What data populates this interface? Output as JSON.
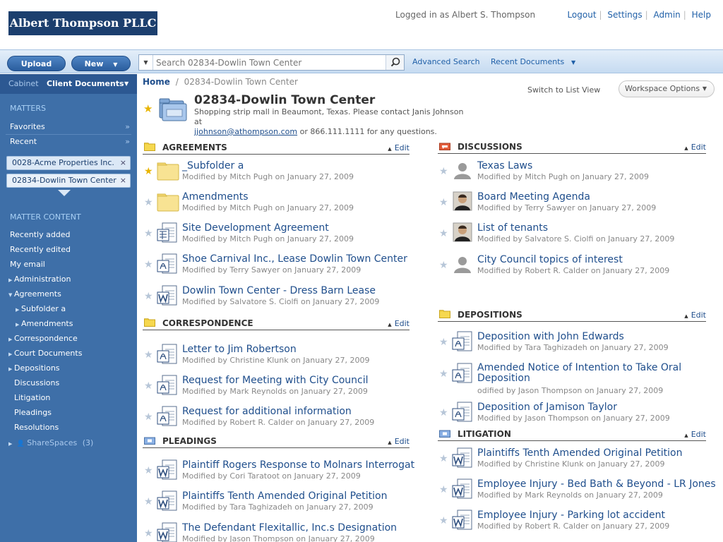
{
  "header": {
    "logo": "Albert Thompson PLLC",
    "logged_in": "Logged in as Albert S. Thompson",
    "links": [
      "Logout",
      "Settings",
      "Admin",
      "Help"
    ],
    "separator": "|"
  },
  "toolbar": {
    "upload": "Upload",
    "new": "New",
    "search_placeholder": "Search 02834-Dowlin Town Center",
    "advanced_search": "Advanced Search",
    "recent_documents": "Recent Documents"
  },
  "sidebar": {
    "cabinet_label": "Cabinet",
    "cabinet_value": "Client Documents",
    "matters_head": "MATTERS",
    "favorites": "Favorites",
    "recent": "Recent",
    "chevron": "»",
    "chip_close": "×",
    "matter_chips": [
      "0028-Acme Properties Inc.",
      "02834-Dowlin Town Center"
    ],
    "matter_content_head": "MATTER CONTENT",
    "content_links": [
      "Recently added",
      "Recently edited",
      "My email"
    ],
    "tree": [
      {
        "label": "Administration",
        "indent": 0,
        "open": false
      },
      {
        "label": "Agreements",
        "indent": 0,
        "open": true
      },
      {
        "label": "Subfolder a",
        "indent": 1,
        "open": false
      },
      {
        "label": "Amendments",
        "indent": 1,
        "open": false
      },
      {
        "label": "Correspondence",
        "indent": 0,
        "open": false
      },
      {
        "label": "Court Documents",
        "indent": 0,
        "open": false
      },
      {
        "label": "Depositions",
        "indent": 0,
        "open": false
      },
      {
        "label": "Discussions",
        "indent": 0,
        "open": null
      },
      {
        "label": "Litigation",
        "indent": 0,
        "open": null
      },
      {
        "label": "Pleadings",
        "indent": 0,
        "open": null
      },
      {
        "label": "Resolutions",
        "indent": 0,
        "open": null
      }
    ],
    "sharespaces": "ShareSpaces",
    "sharespaces_count": "(3)"
  },
  "main": {
    "breadcrumb_home": "Home",
    "breadcrumb_sep": "/",
    "breadcrumb_current": "02834-Dowlin Town Center",
    "switch_view": "Switch to List View",
    "workspace_options": "Workspace Options",
    "title": "02834-Dowlin Town Center",
    "desc_1": "Shopping strip mall in Beaumont, Texas.  Please contact Janis Johnson at",
    "desc_email": "jjohnson@athompson.com",
    "desc_2": " or 866.111.1111 for any questions.",
    "edit_label": "Edit"
  },
  "sections": {
    "agreements": {
      "title": "AGREEMENTS",
      "items": [
        {
          "title": "_Subfolder a",
          "meta": "Modified by Mitch Pugh on January 27, 2009",
          "icon": "folder-icon",
          "fav": true
        },
        {
          "title": "Amendments",
          "meta": "Modified by Mitch Pugh on January 27, 2009",
          "icon": "folder-icon",
          "fav": false
        },
        {
          "title": "Site Development Agreement",
          "meta": "Modified by Mitch Pugh on January 27, 2009",
          "icon": "excel-doc-icon",
          "fav": false
        },
        {
          "title": "Shoe Carnival Inc., Lease Dowlin Town Center",
          "meta": "Modified by Terry Sawyer on January 27, 2009",
          "icon": "pdf-doc-icon",
          "fav": false
        },
        {
          "title": "Dowlin Town Center - Dress Barn Lease",
          "meta": "Modified by Salvatore S. Ciolfi on January 27, 2009",
          "icon": "word-doc-icon",
          "fav": false
        }
      ]
    },
    "correspondence": {
      "title": "CORRESPONDENCE",
      "items": [
        {
          "title": "Letter to Jim Robertson",
          "meta": "Modified by Christine Klunk on January 27, 2009",
          "icon": "pdf-doc-icon"
        },
        {
          "title": "Request for Meeting with City Council",
          "meta": "Modified by Mark Reynolds on January 27, 2009",
          "icon": "pdf-doc-icon"
        },
        {
          "title": "Request for additional information",
          "meta": "Modified by Robert R. Calder on January 27, 2009",
          "icon": "pdf-doc-icon"
        }
      ]
    },
    "pleadings": {
      "title": "PLEADINGS",
      "items": [
        {
          "title": "Plaintiff Rogers Response to Molnars Interrogat",
          "meta": "Modified by Cori Taratoot on January 27, 2009",
          "icon": "word-doc-icon"
        },
        {
          "title": "Plaintiffs Tenth Amended Original Petition",
          "meta": "Modified by Tara Taghizadeh on January 27, 2009",
          "icon": "word-doc-icon"
        },
        {
          "title": "The Defendant Flexitallic, Inc.s Designation",
          "meta": "Modified by Jason Thompson on January 27, 2009",
          "icon": "word-doc-icon"
        }
      ]
    },
    "discussions": {
      "title": "DISCUSSIONS",
      "items": [
        {
          "title": "Texas Laws",
          "meta": "Modified by Mitch Pugh on January 27, 2009",
          "icon": "person-placeholder-icon"
        },
        {
          "title": "Board Meeting Agenda",
          "meta": "Modified by Terry Sawyer on January 27, 2009",
          "icon": "user-photo-icon"
        },
        {
          "title": "List of tenants",
          "meta": "Modified by Salvatore S. Ciolfi on January 27, 2009",
          "icon": "user-photo-icon"
        },
        {
          "title": "City Council topics of interest",
          "meta": "Modified by Robert R. Calder on January 27, 2009",
          "icon": "person-placeholder-icon"
        }
      ]
    },
    "depositions": {
      "title": "DEPOSITIONS",
      "items": [
        {
          "title": "Deposition with John Edwards",
          "meta": "Modified by Tara Taghizadeh on January 27, 2009",
          "icon": "pdf-doc-icon"
        },
        {
          "title": "Amended Notice of Intention to Take Oral Deposition",
          "meta": "odified by Jason Thompson on January 27, 2009",
          "icon": "pdf-doc-icon"
        },
        {
          "title": "Deposition of Jamison Taylor",
          "meta": "Modified by Jason Thompson on January 27, 2009",
          "icon": "pdf-doc-icon"
        }
      ]
    },
    "litigation": {
      "title": "LITIGATION",
      "items": [
        {
          "title": "Plaintiffs Tenth Amended Original Petition",
          "meta": "Modified by Christine Klunk on January 27, 2009",
          "icon": "word-doc-icon"
        },
        {
          "title": "Employee Injury - Bed Bath & Beyond - LR Jones",
          "meta": "Modified by Mark Reynolds on January 27, 2009",
          "icon": "word-doc-icon"
        },
        {
          "title": "Employee Injury - Parking lot accident",
          "meta": "Modified by Robert R. Calder on January 27, 2009",
          "icon": "word-doc-icon"
        }
      ]
    }
  },
  "colors": {
    "brand": "#1c3f6e",
    "sidebar": "#3e6fa8",
    "link": "#1f4e8c",
    "favorite_star": "#e8b400"
  }
}
